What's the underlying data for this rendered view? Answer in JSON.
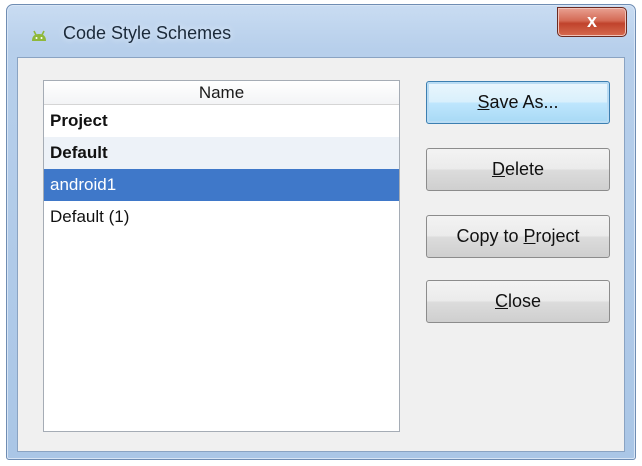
{
  "window": {
    "title": "Code Style Schemes",
    "close_glyph": "x",
    "icon": "android-icon"
  },
  "list": {
    "header": "Name",
    "items": [
      {
        "label": "Project",
        "bold": true,
        "selected": false
      },
      {
        "label": "Default",
        "bold": true,
        "selected": false
      },
      {
        "label": "android1",
        "bold": false,
        "selected": true
      },
      {
        "label": "Default (1)",
        "bold": false,
        "selected": false
      }
    ]
  },
  "buttons": {
    "save_as": {
      "mnemonic": "S",
      "rest": "ave As..."
    },
    "delete": {
      "mnemonic": "D",
      "rest": "elete"
    },
    "copy_to_project": {
      "pre": "Copy to ",
      "mnemonic": "P",
      "rest": "roject"
    },
    "close": {
      "mnemonic": "C",
      "rest": "lose"
    }
  },
  "colors": {
    "selection": "#3f78c9",
    "close_button": "#c0432c",
    "title_bar": "#b7cfeb"
  }
}
